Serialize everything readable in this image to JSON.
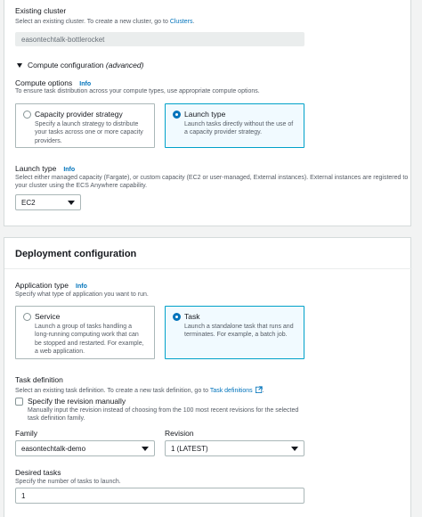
{
  "existing_cluster": {
    "label": "Existing cluster",
    "description_prefix": "Select an existing cluster. To create a new cluster, go to ",
    "clusters_link": "Clusters",
    "description_suffix": ".",
    "value": "easontechtalk-bottlerocket"
  },
  "compute_config": {
    "title": "Compute configuration",
    "qualifier": "(advanced)",
    "expanded": true
  },
  "compute_options": {
    "label": "Compute options",
    "info": "Info",
    "description": "To ensure task distribution across your compute types, use appropriate compute options.",
    "options": [
      {
        "title": "Capacity provider strategy",
        "desc": "Specify a launch strategy to distribute\nyour tasks across one or more capacity\nproviders.",
        "selected": false
      },
      {
        "title": "Launch type",
        "desc": "Launch tasks directly without the use of\na capacity provider strategy.",
        "selected": true
      }
    ]
  },
  "launch_type": {
    "label": "Launch type",
    "info": "Info",
    "description_line1": "Select either managed capacity (Fargate), or custom capacity (EC2 or user-managed, External instances). External instances are registered to",
    "description_line2": "your cluster using the ECS Anywhere capability.",
    "value": "EC2"
  },
  "deployment": {
    "title": "Deployment configuration",
    "application_type": {
      "label": "Application type",
      "info": "Info",
      "description": "Specify what type of application you want to run.",
      "options": [
        {
          "title": "Service",
          "desc": "Launch a group of tasks handling a\nlong-running computing work that can\nbe stopped and restarted. For example,\na web application.",
          "selected": false
        },
        {
          "title": "Task",
          "desc": "Launch a standalone task that runs and\nterminates. For example, a batch job.",
          "selected": true
        }
      ]
    },
    "task_definition": {
      "label": "Task definition",
      "description_prefix": "Select an existing task definition. To create a new task definition, go to ",
      "link": "Task definitions",
      "description_suffix": ".",
      "checkbox_label": "Specify the revision manually",
      "checkbox_desc_line1": "Manually input the revision instead of choosing from the 100 most recent revisions for the selected",
      "checkbox_desc_line2": "task definition family.",
      "checked": false
    },
    "family": {
      "label": "Family",
      "value": "easontechtalk-demo"
    },
    "revision": {
      "label": "Revision",
      "value": "1 (LATEST)"
    },
    "desired_tasks": {
      "label": "Desired tasks",
      "description": "Specify the number of tasks to launch.",
      "value": "1"
    }
  },
  "colors": {
    "accent": "#0073bb",
    "selected_border": "#00a1c9",
    "selected_bg": "#f1faff"
  }
}
